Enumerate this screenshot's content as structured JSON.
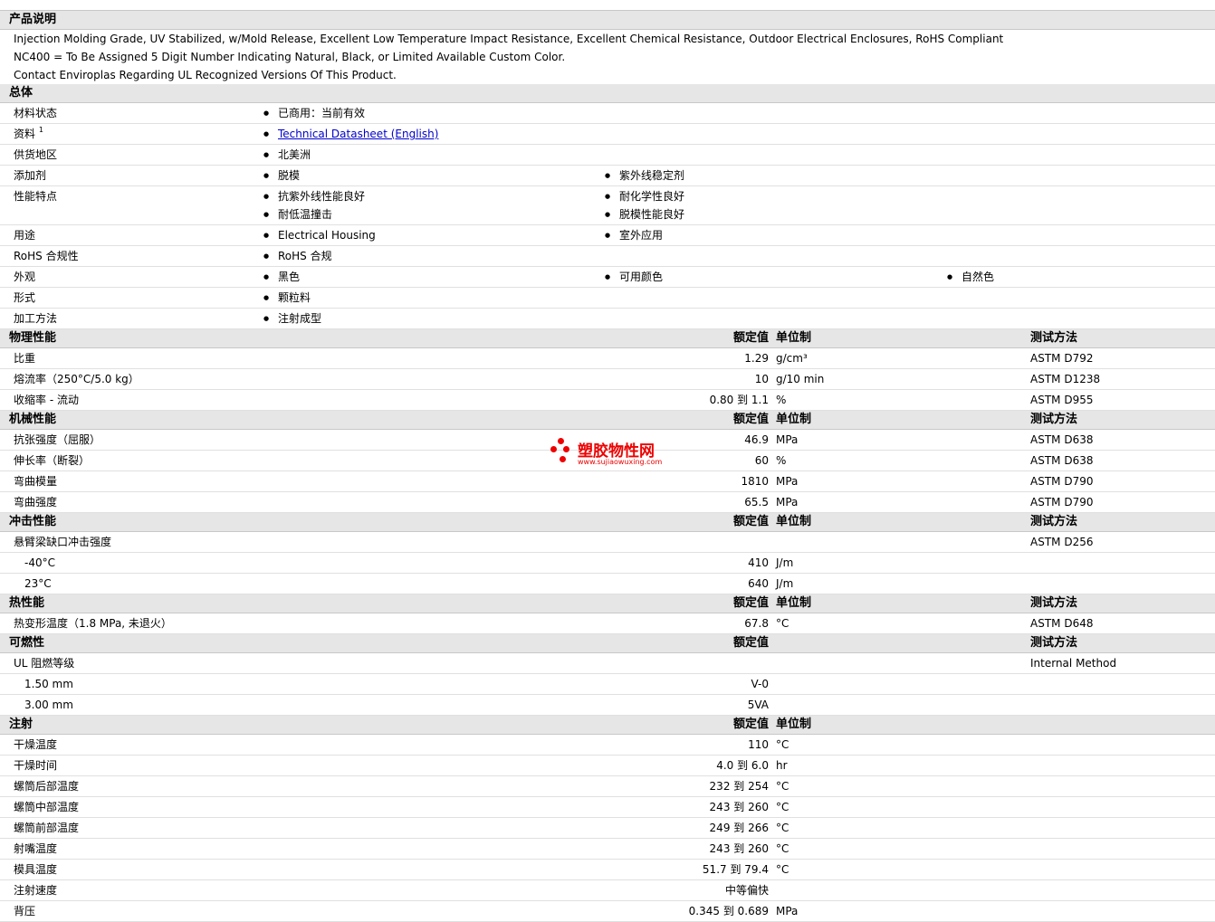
{
  "sections": {
    "product_desc": "产品说明",
    "general": "总体",
    "physical": "物理性能",
    "mechanical": "机械性能",
    "impact": "冲击性能",
    "thermal": "热性能",
    "flammability": "可燃性",
    "injection": "注射"
  },
  "headers": {
    "value": "额定值",
    "unit": "单位制",
    "test": "测试方法"
  },
  "description": [
    "Injection Molding Grade, UV Stabilized, w/Mold Release, Excellent Low Temperature Impact Resistance, Excellent Chemical Resistance, Outdoor Electrical Enclosures, RoHS Compliant",
    "NC400 = To Be Assigned 5 Digit Number Indicating Natural, Black, or Limited Available Custom Color.",
    "Contact Enviroplas Regarding UL Recognized Versions Of This Product."
  ],
  "general": {
    "status_label": "材料状态",
    "status": "已商用：当前有效",
    "doc_label": "资料",
    "doc_sup": "1",
    "doc_link": "Technical Datasheet (English)",
    "region_label": "供货地区",
    "region": "北美洲",
    "additive_label": "添加剂",
    "additive1": "脱模",
    "additive2": "紫外线稳定剂",
    "feature_label": "性能特点",
    "feature1": "抗紫外线性能良好",
    "feature2": "耐化学性良好",
    "feature3": "耐低温撞击",
    "feature4": "脱模性能良好",
    "use_label": "用途",
    "use1": "Electrical Housing",
    "use2": "室外应用",
    "rohs_label": "RoHS 合规性",
    "rohs": "RoHS 合规",
    "appearance_label": "外观",
    "appearance1": "黑色",
    "appearance2": "可用颜色",
    "appearance3": "自然色",
    "form_label": "形式",
    "form": "颗粒料",
    "process_label": "加工方法",
    "process": "注射成型"
  },
  "physical": [
    {
      "label": "比重",
      "value": "1.29",
      "unit": "g/cm³",
      "test": "ASTM D792"
    },
    {
      "label": "熔流率（250°C/5.0 kg）",
      "value": "10",
      "unit": "g/10 min",
      "test": "ASTM D1238"
    },
    {
      "label": "收缩率 - 流动",
      "value": "0.80 到 1.1",
      "unit": "%",
      "test": "ASTM D955"
    }
  ],
  "mechanical": [
    {
      "label": "抗张强度（屈服）",
      "value": "46.9",
      "unit": "MPa",
      "test": "ASTM D638"
    },
    {
      "label": "伸长率（断裂）",
      "value": "60",
      "unit": "%",
      "test": "ASTM D638"
    },
    {
      "label": "弯曲模量",
      "value": "1810",
      "unit": "MPa",
      "test": "ASTM D790"
    },
    {
      "label": "弯曲强度",
      "value": "65.5",
      "unit": "MPa",
      "test": "ASTM D790"
    }
  ],
  "impact": {
    "label": "悬臂梁缺口冲击强度",
    "test": "ASTM D256",
    "rows": [
      {
        "label": "-40°C",
        "value": "410",
        "unit": "J/m"
      },
      {
        "label": "23°C",
        "value": "640",
        "unit": "J/m"
      }
    ]
  },
  "thermal": [
    {
      "label": "热变形温度（1.8 MPa, 未退火）",
      "value": "67.8",
      "unit": "°C",
      "test": "ASTM D648"
    }
  ],
  "flammability": {
    "label": "UL 阻燃等级",
    "test": "Internal Method",
    "rows": [
      {
        "label": "1.50 mm",
        "value": "V-0"
      },
      {
        "label": "3.00 mm",
        "value": "5VA"
      }
    ]
  },
  "injection": [
    {
      "label": "干燥温度",
      "value": "110",
      "unit": "°C"
    },
    {
      "label": "干燥时间",
      "value": "4.0 到 6.0",
      "unit": "hr"
    },
    {
      "label": "螺筒后部温度",
      "value": "232 到 254",
      "unit": "°C"
    },
    {
      "label": "螺筒中部温度",
      "value": "243 到 260",
      "unit": "°C"
    },
    {
      "label": "螺筒前部温度",
      "value": "249 到 266",
      "unit": "°C"
    },
    {
      "label": "射嘴温度",
      "value": "243 到 260",
      "unit": "°C"
    },
    {
      "label": "模具温度",
      "value": "51.7 到 79.4",
      "unit": "°C"
    },
    {
      "label": "注射速度",
      "value": "中等偏快",
      "unit": ""
    },
    {
      "label": "背压",
      "value": "0.345 到 0.689",
      "unit": "MPa"
    }
  ],
  "watermark": {
    "name": "塑胶物性网",
    "url": "www.sujiaowuxing.com"
  }
}
